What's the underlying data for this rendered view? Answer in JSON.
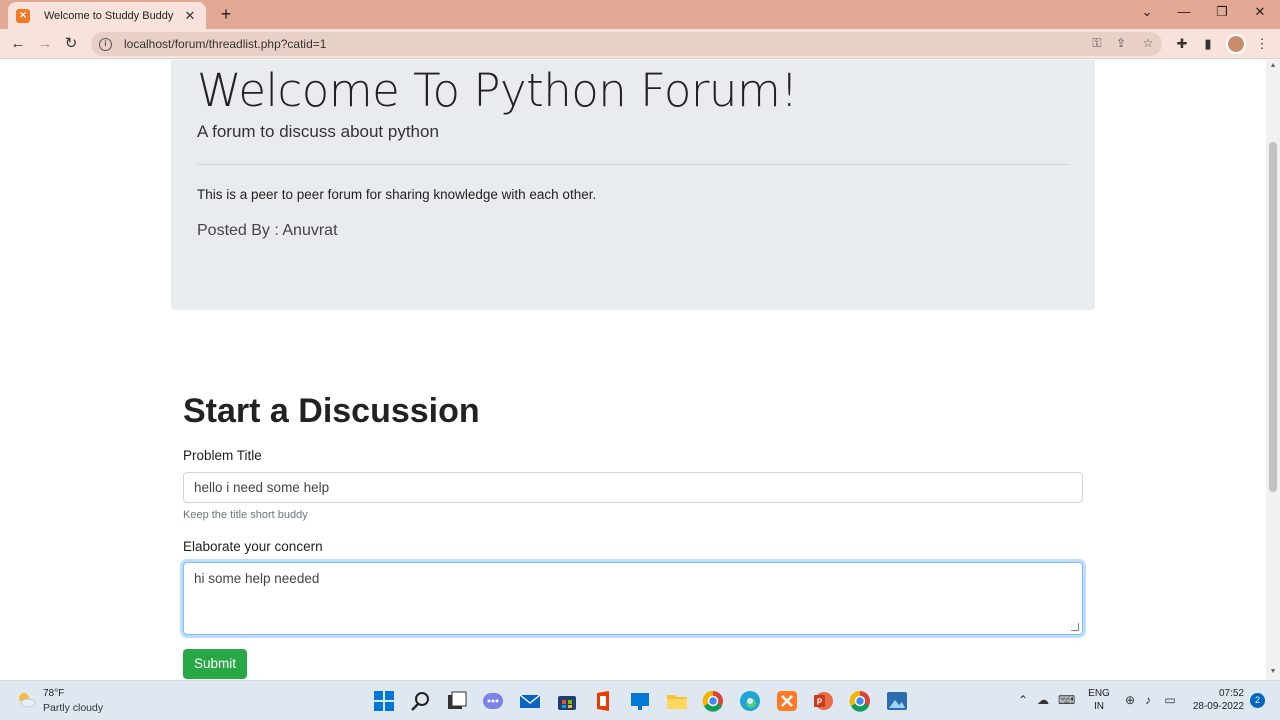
{
  "browser": {
    "tab_title": "Welcome to Studdy Buddy",
    "url": "localhost/forum/threadlist.php?catid=1"
  },
  "jumbotron": {
    "title": "Welcome To Python Forum!",
    "subtitle": "A forum to discuss about python",
    "description": "This is a peer to peer forum for sharing knowledge with each other.",
    "posted_by": "Posted By : Anuvrat"
  },
  "form": {
    "heading": "Start a Discussion",
    "title_label": "Problem Title",
    "title_value": "hello i need some help",
    "title_help": "Keep the title short buddy",
    "concern_label": "Elaborate your concern",
    "concern_value": "hi some help needed",
    "submit_label": "Submit"
  },
  "taskbar": {
    "temperature": "78°F",
    "weather": "Partly cloudy",
    "lang_top": "ENG",
    "lang_bottom": "IN",
    "time": "07:52",
    "date": "28-09-2022",
    "notifications": "2"
  },
  "colors": {
    "tab_strip": "#e2a995",
    "submit_button": "#28a745",
    "jumbotron_bg": "#e9ecef"
  }
}
